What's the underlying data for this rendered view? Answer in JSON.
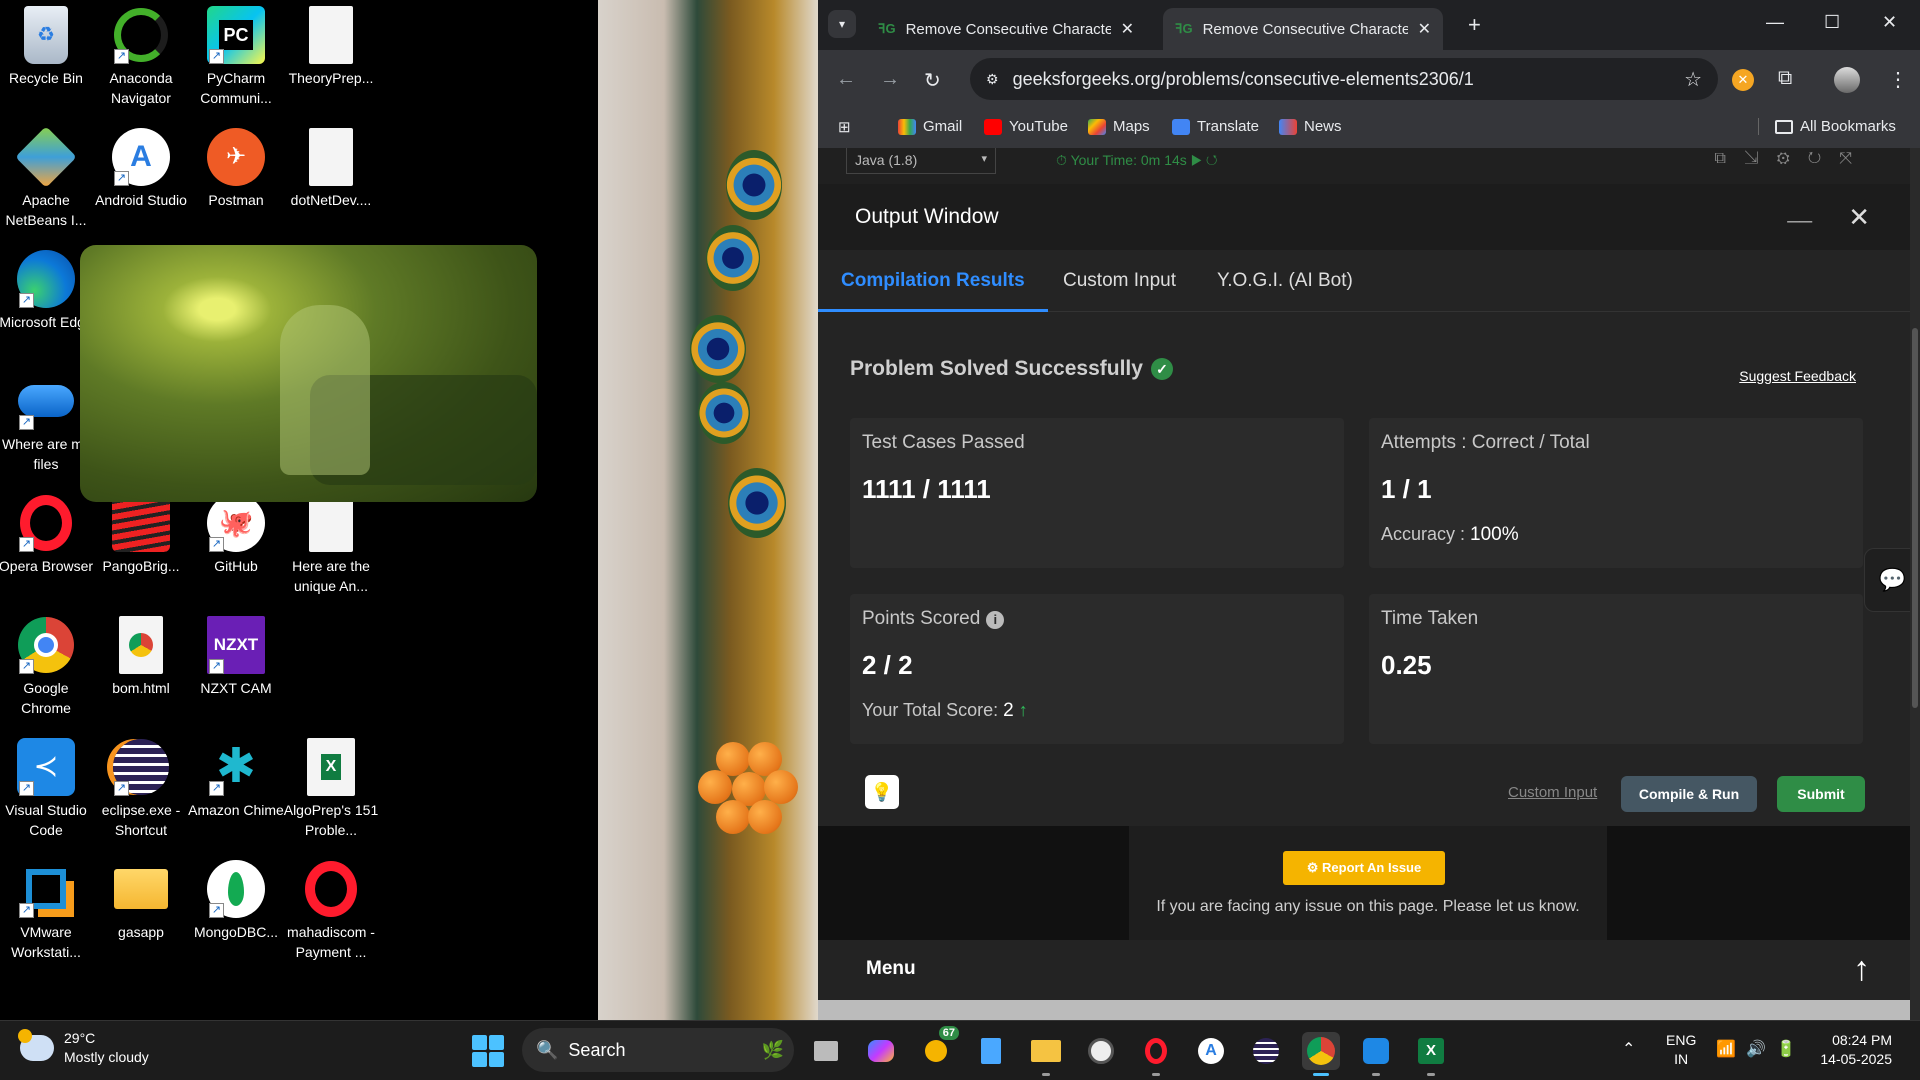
{
  "desktop": {
    "icons": [
      {
        "label": "Recycle Bin"
      },
      {
        "label": "Anaconda Navigator"
      },
      {
        "label": "PyCharm Communi..."
      },
      {
        "label": "TheoryPrep..."
      },
      {
        "label": "Apache NetBeans I..."
      },
      {
        "label": "Android Studio"
      },
      {
        "label": "Postman"
      },
      {
        "label": "dotNetDev...."
      },
      {
        "label": "Microsoft Edge"
      },
      {
        "label": "Where are my files"
      },
      {
        "label": "Opera Browser"
      },
      {
        "label": "PangoBrig..."
      },
      {
        "label": "GitHub"
      },
      {
        "label": "Here are the unique An..."
      },
      {
        "label": "Google Chrome"
      },
      {
        "label": "bom.html"
      },
      {
        "label": "NZXT CAM"
      },
      {
        "label": "Visual Studio Code"
      },
      {
        "label": "eclipse.exe - Shortcut"
      },
      {
        "label": "Amazon Chime"
      },
      {
        "label": "AlgoPrep's 151 Proble..."
      },
      {
        "label": "VMware Workstati..."
      },
      {
        "label": "gasapp"
      },
      {
        "label": "MongoDBC..."
      },
      {
        "label": "mahadiscom - Payment ..."
      }
    ],
    "pycharm_glyph": "PC",
    "nzxt_glyph": "NZXT"
  },
  "browser": {
    "tabs": [
      {
        "title": "Remove Consecutive Characters",
        "active": false
      },
      {
        "title": "Remove Consecutive Characters",
        "active": true
      }
    ],
    "url": "geeksforgeeks.org/problems/consecutive-elements2306/1",
    "bookmarks": [
      "Gmail",
      "YouTube",
      "Maps",
      "Translate",
      "News"
    ],
    "all_bookmarks": "All Bookmarks"
  },
  "editor": {
    "language": "Java (1.8)",
    "timer": "Your Time: 0m 14s"
  },
  "output": {
    "title": "Output Window",
    "tabs": [
      "Compilation Results",
      "Custom Input",
      "Y.O.G.I. (AI Bot)"
    ],
    "status": "Problem Solved Successfully",
    "suggest_feedback": "Suggest Feedback",
    "cards": {
      "test_cases": {
        "label": "Test Cases Passed",
        "value": "1111 / 1111"
      },
      "attempts": {
        "label": "Attempts : Correct / Total",
        "value": "1 / 1",
        "accuracy_label": "Accuracy :",
        "accuracy_value": "100%"
      },
      "points": {
        "label": "Points Scored",
        "value": "2 / 2",
        "total_label": "Your Total Score:",
        "total_value": "2"
      },
      "time": {
        "label": "Time Taken",
        "value": "0.25"
      }
    },
    "custom_input_link": "Custom Input",
    "compile_run": "Compile & Run",
    "submit": "Submit"
  },
  "issue": {
    "button": "Report An Issue",
    "text": "If you are facing any issue on this page. Please let us know."
  },
  "menu": {
    "label": "Menu"
  },
  "taskbar": {
    "weather_temp": "29°C",
    "weather_desc": "Mostly cloudy",
    "search_label": "Search",
    "badge_count": "67",
    "lang_top": "ENG",
    "lang_bottom": "IN",
    "time": "08:24 PM",
    "date": "14-05-2025"
  },
  "colors": {
    "gfg_green": "#2f8d46",
    "active_tab_blue": "#2f8dff",
    "report_yellow": "#f5b400",
    "compile_btn": "#455763"
  }
}
